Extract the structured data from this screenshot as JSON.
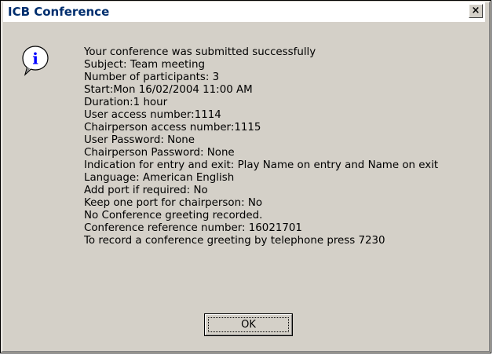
{
  "window": {
    "title": "ICB Conference",
    "close_glyph": "×"
  },
  "icon": {
    "name": "information-icon",
    "glyph": "i",
    "color": "#0000ff"
  },
  "message": {
    "lines": [
      "Your conference was submitted successfully",
      "Subject: Team meeting",
      "Number of participants: 3",
      "Start:Mon 16/02/2004 11:00 AM",
      "Duration:1 hour",
      "User access number:1114",
      "Chairperson access number:1115",
      "User Password: None",
      "Chairperson Password: None",
      "Indication for entry and exit: Play Name on entry and Name on exit",
      "Language: American English",
      "Add port if required: No",
      "Keep one port for chairperson: No",
      "No Conference greeting recorded.",
      "Conference reference number: 16021701",
      "To record a conference greeting by telephone press 7230"
    ]
  },
  "buttons": {
    "ok_label": "OK"
  },
  "colors": {
    "dialog_face": "#d4d0c8",
    "title_text": "#002e6e"
  }
}
